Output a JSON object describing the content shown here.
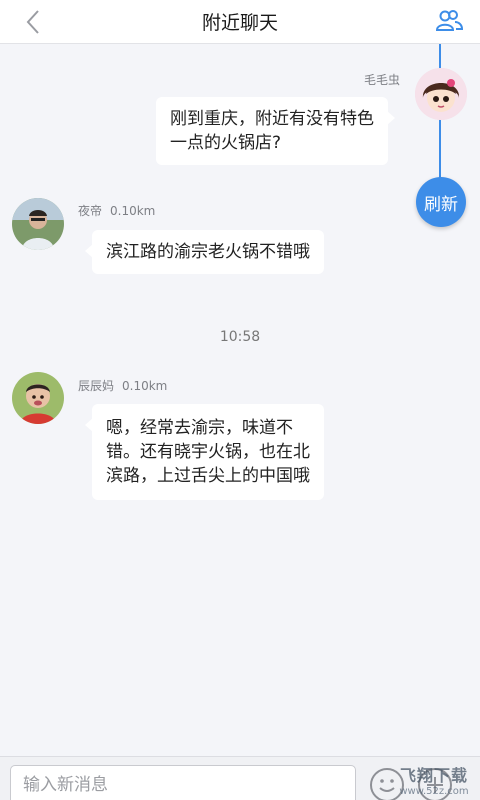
{
  "header": {
    "title": "附近聊天",
    "back_icon": "chevron-left-icon",
    "friends_icon": "people-icon"
  },
  "refresh": {
    "label": "刷新"
  },
  "messages": [
    {
      "sender": "毛毛虫",
      "distance": "",
      "text": "刚到重庆，附近有没有特色一点的火锅店?",
      "side": "right",
      "avatar": "cartoon-girl-avatar"
    },
    {
      "sender": "夜帝",
      "distance": "0.10km",
      "text": "滨江路的渝宗老火锅不错哦",
      "side": "left",
      "avatar": "man-photo-avatar"
    },
    {
      "sender": "辰辰妈",
      "distance": "0.10km",
      "text": "嗯，经常去渝宗，味道不错。还有晓宇火锅，也在北滨路，上过舌尖上的中国哦",
      "side": "left",
      "avatar": "child-photo-avatar"
    }
  ],
  "timestamp": "10:58",
  "composer": {
    "placeholder": "输入新消息",
    "emoji_icon": "emoji-icon",
    "plus_icon": "plus-icon"
  },
  "watermark": {
    "main": "飞翔下载",
    "sub": "www.52z.com"
  },
  "colors": {
    "accent": "#3d8de8",
    "background": "#f4f5f9",
    "bubble": "#ffffff"
  }
}
